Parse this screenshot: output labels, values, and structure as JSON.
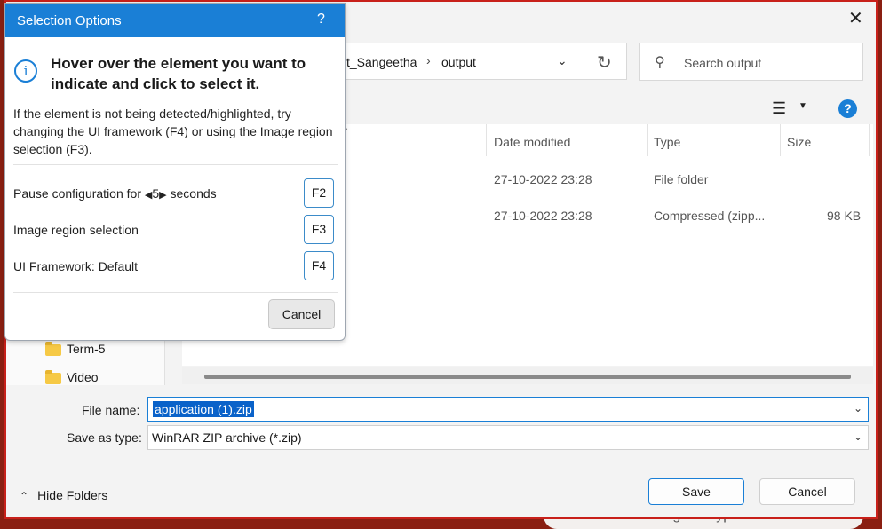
{
  "background": {
    "browser_search_text": "Search Google or type a URL"
  },
  "save_dialog": {
    "breadcrumb": [
      "t_Sangeetha",
      "output"
    ],
    "search_placeholder": "Search output",
    "columns": {
      "date_modified": "Date modified",
      "type": "Type",
      "size": "Size"
    },
    "files": [
      {
        "date": "27-10-2022 23:28",
        "type": "File folder",
        "size": ""
      },
      {
        "date": "27-10-2022 23:28",
        "type": "Compressed (zipp...",
        "size": "98 KB"
      }
    ],
    "tree_items": [
      "Term-5",
      "Video"
    ],
    "file_name_label": "File name:",
    "file_name_value": "application (1).zip",
    "save_as_type_label": "Save as type:",
    "save_as_type_value": "WinRAR ZIP archive (*.zip)",
    "hide_folders_label": "Hide Folders",
    "save_label": "Save",
    "cancel_label": "Cancel",
    "help_glyph": "?"
  },
  "selection_options": {
    "title": "Selection Options",
    "help_glyph": "?",
    "heading": "Hover over the element you want to indicate and click to select it.",
    "description": "If the element is not being detected/highlighted, try changing the UI framework (F4) or using the Image region selection (F3).",
    "pause_prefix": "Pause configuration for",
    "pause_value": "5",
    "pause_suffix": "seconds",
    "pause_key": "F2",
    "image_region_label": "Image region selection",
    "image_region_key": "F3",
    "ui_framework_label": "UI Framework:",
    "ui_framework_value": "Default",
    "ui_framework_key": "F4",
    "cancel_label": "Cancel"
  },
  "colors": {
    "accent": "#1a7fd6",
    "highlight_border": "#c8201a"
  }
}
